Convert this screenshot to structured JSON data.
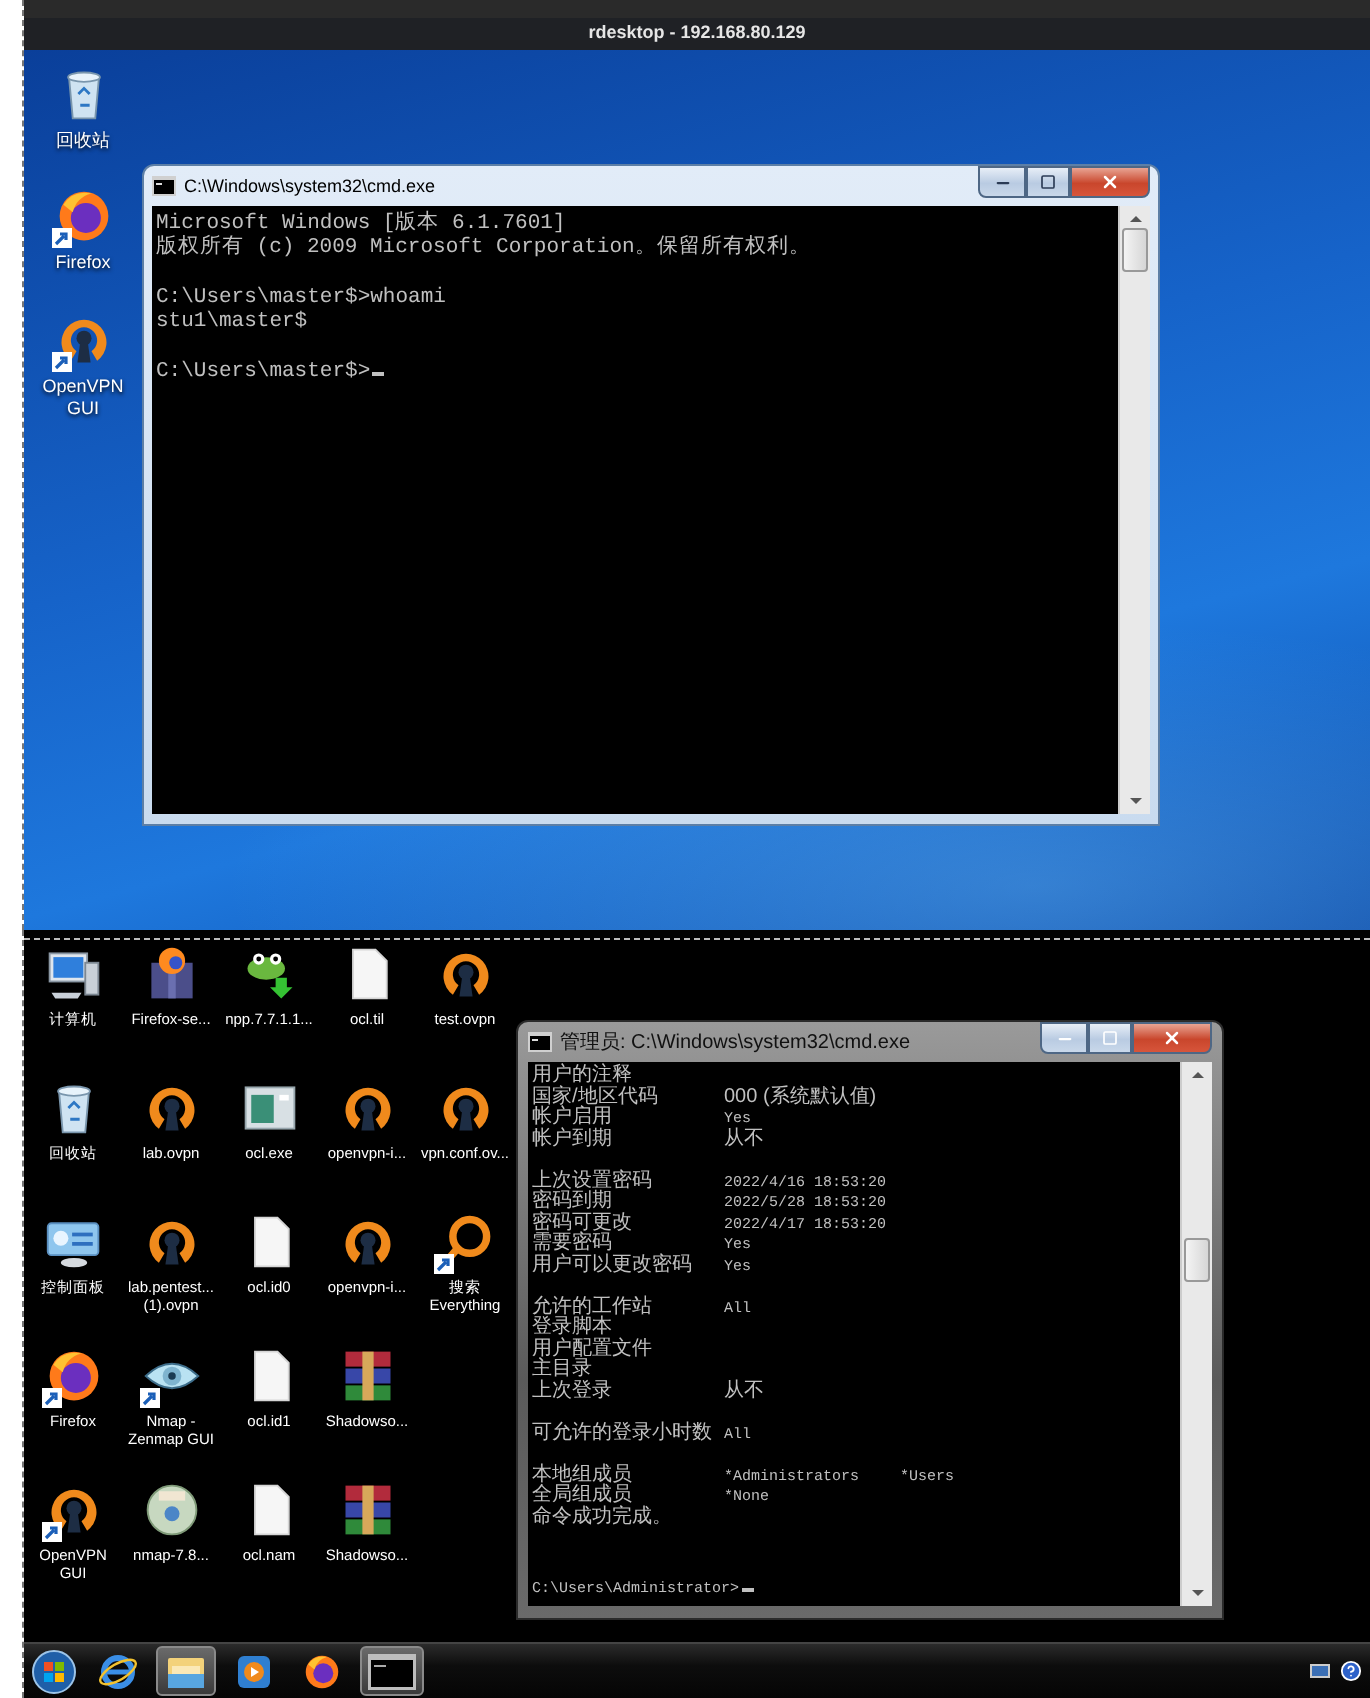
{
  "remote_window": {
    "title": "rdesktop - 192.168.80.129"
  },
  "remote_desktop": {
    "icons": [
      {
        "kind": "recycle",
        "label": "回收站",
        "shortcut": false
      },
      {
        "kind": "firefox",
        "label": "Firefox",
        "shortcut": true
      },
      {
        "kind": "openvpn",
        "label": "OpenVPN\nGUI",
        "shortcut": true
      }
    ],
    "console": {
      "title": "C:\\Windows\\system32\\cmd.exe",
      "blocks": [
        [
          "Microsoft Windows [版本 6.1.7601]",
          "版权所有 (c) 2009 Microsoft Corporation。保留所有权利。"
        ],
        [
          "C:\\Users\\master$>whoami",
          "stu1\\master$"
        ],
        [
          "C:\\Users\\master$>"
        ]
      ],
      "cursor": true
    }
  },
  "local_desktop": {
    "icon_rows": [
      [
        {
          "kind": "computer",
          "label": "计算机",
          "shortcut": false
        },
        {
          "kind": "installer",
          "label": "Firefox-se...",
          "shortcut": false
        },
        {
          "kind": "lizard",
          "label": "npp.7.7.1.1...",
          "shortcut": false
        },
        {
          "kind": "file",
          "label": "ocl.til",
          "shortcut": false
        },
        {
          "kind": "openvpn",
          "label": "test.ovpn",
          "shortcut": false
        }
      ],
      [
        {
          "kind": "recycle",
          "label": "回收站",
          "shortcut": false
        },
        {
          "kind": "openvpn",
          "label": "lab.ovpn",
          "shortcut": false
        },
        {
          "kind": "app",
          "label": "ocl.exe",
          "shortcut": false
        },
        {
          "kind": "openvpn",
          "label": "openvpn-i...",
          "shortcut": false
        },
        {
          "kind": "openvpn",
          "label": "vpn.conf.ov...",
          "shortcut": false
        }
      ],
      [
        {
          "kind": "control",
          "label": "控制面板",
          "shortcut": false
        },
        {
          "kind": "openvpn",
          "label": "lab.pentest...\n(1).ovpn",
          "shortcut": false
        },
        {
          "kind": "file",
          "label": "ocl.id0",
          "shortcut": false
        },
        {
          "kind": "openvpn",
          "label": "openvpn-i...",
          "shortcut": false
        },
        {
          "kind": "search",
          "label": "搜索\nEverything",
          "shortcut": true
        }
      ],
      [
        {
          "kind": "firefox",
          "label": "Firefox",
          "shortcut": true
        },
        {
          "kind": "eye",
          "label": "Nmap -\nZenmap GUI",
          "shortcut": true
        },
        {
          "kind": "file",
          "label": "ocl.id1",
          "shortcut": false
        },
        {
          "kind": "archive",
          "label": "Shadowso...",
          "shortcut": false
        }
      ],
      [
        {
          "kind": "openvpn",
          "label": "OpenVPN\nGUI",
          "shortcut": true
        },
        {
          "kind": "disc",
          "label": "nmap-7.8...",
          "shortcut": false
        },
        {
          "kind": "file",
          "label": "ocl.nam",
          "shortcut": false
        },
        {
          "kind": "archive",
          "label": "Shadowso...",
          "shortcut": false
        }
      ]
    ],
    "console": {
      "title": "管理员: C:\\Windows\\system32\\cmd.exe",
      "blocks": [
        [
          {
            "label": "用户的注释"
          },
          {
            "label": "国家/地区代码",
            "value": "000 (系统默认值)"
          },
          {
            "label": "帐户启用",
            "value": "Yes"
          },
          {
            "label": "帐户到期",
            "value": "从不"
          }
        ],
        [
          {
            "label": "上次设置密码",
            "value": "2022/4/16 18:53:20"
          },
          {
            "label": "密码到期",
            "value": "2022/5/28 18:53:20"
          },
          {
            "label": "密码可更改",
            "value": "2022/4/17 18:53:20"
          },
          {
            "label": "需要密码",
            "value": "Yes"
          },
          {
            "label": "用户可以更改密码",
            "value": "Yes"
          }
        ],
        [
          {
            "label": "允许的工作站",
            "value": "All"
          },
          {
            "label": "登录脚本"
          },
          {
            "label": "用户配置文件"
          },
          {
            "label": "主目录"
          },
          {
            "label": "上次登录",
            "value": "从不"
          }
        ],
        [
          {
            "label": "可允许的登录小时数",
            "value": "All"
          }
        ],
        [
          {
            "label": "本地组成员",
            "value": "*Administrators",
            "value2": "*Users"
          },
          {
            "label": "全局组成员",
            "value": "*None"
          },
          {
            "label": "命令成功完成。"
          }
        ]
      ],
      "prompt": "C:\\Users\\Administrator>",
      "cursor": true
    }
  },
  "taskbar": {
    "items": [
      {
        "kind": "start",
        "running": false
      },
      {
        "kind": "browser",
        "running": false
      },
      {
        "kind": "folder",
        "running": true
      },
      {
        "kind": "media",
        "running": false
      },
      {
        "kind": "firefox",
        "running": false
      },
      {
        "kind": "terminal",
        "running": true
      }
    ]
  }
}
